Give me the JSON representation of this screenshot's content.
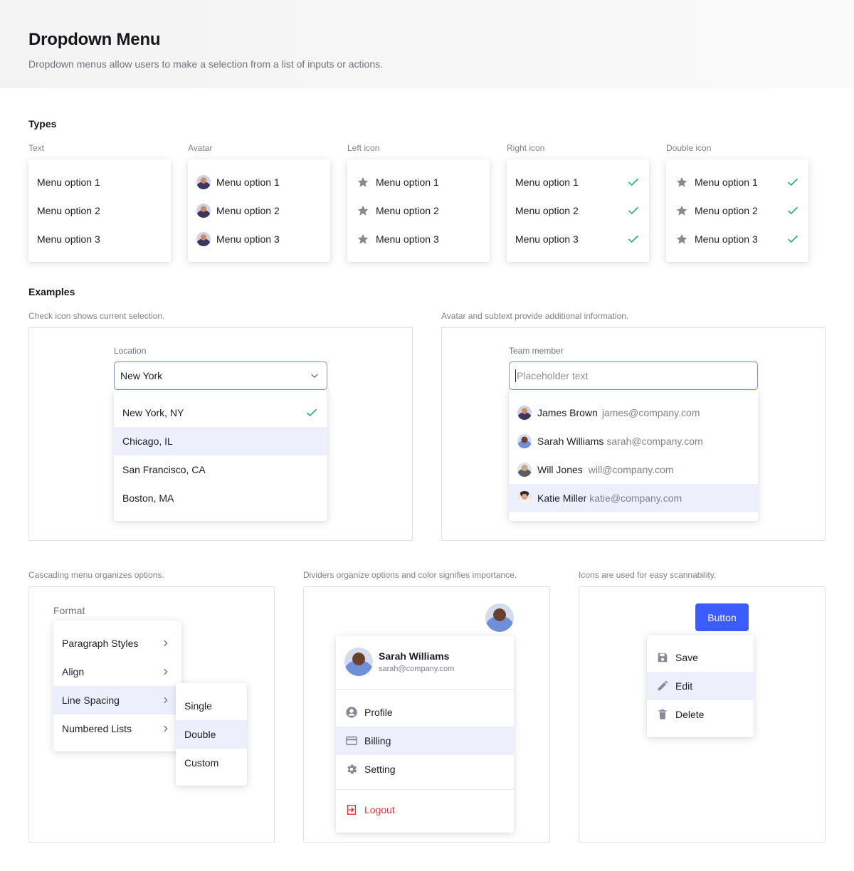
{
  "header": {
    "title": "Dropdown Menu",
    "description": "Dropdown menus allow users to make a selection from a list of inputs or actions."
  },
  "types": {
    "title": "Types",
    "columns": [
      {
        "label": "Text",
        "items": [
          "Menu option 1",
          "Menu option 2",
          "Menu option 3"
        ]
      },
      {
        "label": "Avatar",
        "items": [
          "Menu option 1",
          "Menu option 2",
          "Menu option 3"
        ]
      },
      {
        "label": "Left icon",
        "items": [
          "Menu option 1",
          "Menu option 2",
          "Menu option 3"
        ]
      },
      {
        "label": "Right icon",
        "items": [
          "Menu option 1",
          "Menu option 2",
          "Menu option 3"
        ]
      },
      {
        "label": "Double icon",
        "items": [
          "Menu option 1",
          "Menu option 2",
          "Menu option 3"
        ]
      }
    ]
  },
  "examples": {
    "title": "Examples",
    "location": {
      "caption": "Check icon shows current selection.",
      "field_label": "Location",
      "value": "New York",
      "options": [
        "New York, NY",
        "Chicago, IL",
        "San Francisco, CA",
        "Boston, MA"
      ],
      "selected": "New York, NY",
      "highlighted": "Chicago, IL"
    },
    "team": {
      "caption": "Avatar and subtext provide additional information.",
      "field_label": "Team member",
      "placeholder": "Placeholder text",
      "members": [
        {
          "name": "James Brown",
          "email": "james@company.com"
        },
        {
          "name": "Sarah Williams",
          "email": "sarah@company.com"
        },
        {
          "name": "Will Jones",
          "email": "will@company.com"
        },
        {
          "name": "Katie Miller",
          "email": "katie@company.com"
        }
      ],
      "highlighted": "Katie Miller"
    },
    "cascading": {
      "caption": "Cascading menu organizes options.",
      "label": "Format",
      "items": [
        "Paragraph Styles",
        "Align",
        "Line Spacing",
        "Numbered Lists"
      ],
      "highlighted": "Line Spacing",
      "submenu": [
        "Single",
        "Double",
        "Custom"
      ],
      "submenu_highlighted": "Double"
    },
    "dividers": {
      "caption": "Dividers organize options and color signifies importance.",
      "user_name": "Sarah Williams",
      "user_email": "sarah@company.com",
      "items": [
        "Profile",
        "Billing",
        "Setting"
      ],
      "highlighted": "Billing",
      "logout": "Logout"
    },
    "icons": {
      "caption": "Icons are used for easy scannability.",
      "button": "Button",
      "items": [
        "Save",
        "Edit",
        "Delete"
      ],
      "highlighted": "Edit"
    }
  },
  "colors": {
    "accent": "#3d5cff",
    "check": "#36b37e",
    "highlight": "#edf0fc",
    "danger": "#e5333f"
  }
}
